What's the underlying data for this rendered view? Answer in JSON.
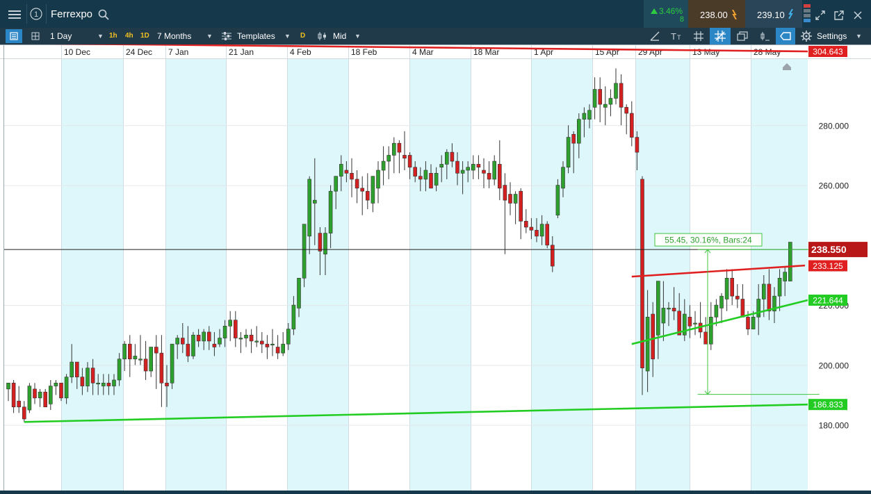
{
  "header": {
    "instrument": "Ferrexpo",
    "change_pct": "3.46%",
    "change_points": "8",
    "sell_price": "238.00",
    "buy_price": "239.10"
  },
  "toolbar": {
    "timeframe": "1 Day",
    "quick_1h": "1h",
    "quick_4h": "4h",
    "quick_1d": "1D",
    "range": "7 Months",
    "templates": "Templates",
    "d_badge": "D",
    "price_type": "Mid",
    "settings": "Settings"
  },
  "colors": {
    "up": "#2ea02e",
    "down": "#d42020",
    "resistance": "#e02020",
    "support": "#22cc22",
    "band": "#ddf7fa",
    "topbar": "#15384b",
    "toolbar": "#213a4a"
  },
  "chart_data": {
    "type": "candlestick",
    "x_tick_labels": [
      "10 Dec",
      "24 Dec",
      "7 Jan",
      "21 Jan",
      "4 Feb",
      "18 Feb",
      "4 Mar",
      "18 Mar",
      "1 Apr",
      "15 Apr",
      "29 Apr",
      "13 May",
      "28 May"
    ],
    "y_tick_labels": [
      "180.000",
      "200.000",
      "220.000",
      "260.000",
      "280.000"
    ],
    "y_ticks": [
      180,
      200,
      220,
      260,
      280
    ],
    "ylim": [
      172.5,
      306.5
    ],
    "current_price_label": "238.550",
    "current_price": 238.55,
    "price_labels": [
      {
        "text": "304.643",
        "value": 304.643,
        "color": "#e02020"
      },
      {
        "text": "233.125",
        "value": 233.125,
        "color": "#e02020"
      },
      {
        "text": "221.644",
        "value": 221.644,
        "color": "#22cc22"
      },
      {
        "text": "186.833",
        "value": 186.833,
        "color": "#22cc22"
      }
    ],
    "measure_label": "55.45, 30.16%, Bars:24",
    "measure": {
      "from_value": 190.2,
      "to_value": 238.55,
      "from_index": 131,
      "to_index": 153
    },
    "trendlines": [
      {
        "role": "long-term resistance",
        "color": "#e02020",
        "from_index": 0,
        "from_value": 307.4,
        "to_index": 153,
        "to_value": 304.643,
        "dashed_extension": false
      },
      {
        "role": "long-term support",
        "color": "#22cc22",
        "from_index": 3,
        "from_value": 181.0,
        "to_index": 153,
        "to_value": 186.833,
        "dashed_extension": false
      },
      {
        "role": "wedge resistance",
        "color": "#e02020",
        "from_index": 118,
        "from_value": 229.5,
        "to_index": 150,
        "to_value": 233.125,
        "dashed_extension": true
      },
      {
        "role": "wedge support",
        "color": "#22cc22",
        "from_index": 118,
        "from_value": 207.0,
        "to_index": 153,
        "to_value": 221.644,
        "dashed_extension": false
      }
    ],
    "candles": [
      [
        192,
        194,
        188,
        194
      ],
      [
        194,
        195,
        184,
        186
      ],
      [
        188,
        193,
        184,
        186
      ],
      [
        186,
        188,
        181,
        182
      ],
      [
        185,
        194,
        184,
        193
      ],
      [
        192,
        194,
        187,
        189
      ],
      [
        189,
        192,
        186,
        191
      ],
      [
        191,
        192,
        186,
        186
      ],
      [
        187,
        195,
        185,
        193
      ],
      [
        193,
        195,
        190,
        194
      ],
      [
        194,
        194,
        188,
        189
      ],
      [
        189,
        197,
        187,
        196
      ],
      [
        196,
        207,
        194,
        201
      ],
      [
        201,
        201,
        192,
        196
      ],
      [
        196,
        199,
        190,
        193
      ],
      [
        193,
        201,
        191,
        199
      ],
      [
        199,
        202,
        190,
        194
      ],
      [
        194,
        197,
        190,
        194
      ],
      [
        193,
        197,
        190,
        194
      ],
      [
        194,
        197,
        190,
        193
      ],
      [
        193,
        197,
        190,
        195
      ],
      [
        195,
        204,
        193,
        202
      ],
      [
        202,
        208,
        198,
        207
      ],
      [
        207,
        210,
        196,
        202
      ],
      [
        202,
        207,
        200,
        203
      ],
      [
        202,
        210,
        200,
        202
      ],
      [
        202,
        208,
        195,
        198
      ],
      [
        198,
        206,
        196,
        206
      ],
      [
        206,
        210,
        192,
        204
      ],
      [
        204,
        210,
        186,
        194
      ],
      [
        194,
        200,
        186,
        193
      ],
      [
        194,
        207,
        192,
        207
      ],
      [
        207,
        210,
        202,
        209
      ],
      [
        209,
        214,
        204,
        207
      ],
      [
        207,
        213,
        201,
        203
      ],
      [
        203,
        211,
        202,
        210
      ],
      [
        210,
        212,
        206,
        208
      ],
      [
        208,
        212,
        205,
        211
      ],
      [
        211,
        213,
        205,
        208
      ],
      [
        207,
        211,
        203,
        206
      ],
      [
        207,
        212,
        206,
        209
      ],
      [
        209,
        215,
        206,
        213
      ],
      [
        213,
        218,
        208,
        215
      ],
      [
        215,
        218,
        206,
        209
      ],
      [
        209,
        211,
        204,
        209
      ],
      [
        209,
        212,
        206,
        210
      ],
      [
        210,
        212,
        204,
        208
      ],
      [
        208,
        213,
        206,
        208
      ],
      [
        208,
        211,
        204,
        207
      ],
      [
        207,
        210,
        202,
        206
      ],
      [
        207,
        212,
        203,
        207
      ],
      [
        206,
        210,
        202,
        204
      ],
      [
        204,
        211,
        203,
        207
      ],
      [
        207,
        214,
        205,
        212
      ],
      [
        212,
        223,
        210,
        220
      ],
      [
        219,
        228,
        216,
        229
      ],
      [
        229,
        243,
        226,
        247
      ],
      [
        243,
        263,
        237,
        262
      ],
      [
        254,
        269,
        240,
        255
      ],
      [
        244,
        246,
        230,
        238
      ],
      [
        237,
        246,
        230,
        244
      ],
      [
        244,
        260,
        239,
        258
      ],
      [
        258,
        262,
        252,
        263
      ],
      [
        263,
        270,
        258,
        267
      ],
      [
        265,
        268,
        261,
        264
      ],
      [
        264,
        269,
        256,
        262
      ],
      [
        262,
        265,
        254,
        259
      ],
      [
        259,
        263,
        250,
        258
      ],
      [
        258,
        264,
        252,
        255
      ],
      [
        254,
        263,
        251,
        263
      ],
      [
        259,
        268,
        254,
        265
      ],
      [
        265,
        273,
        260,
        268
      ],
      [
        268,
        273,
        262,
        270
      ],
      [
        270,
        276,
        264,
        274
      ],
      [
        274,
        275,
        264,
        271
      ],
      [
        270,
        278,
        265,
        269
      ],
      [
        270,
        271,
        262,
        266
      ],
      [
        266,
        268,
        261,
        263
      ],
      [
        263,
        266,
        258,
        262
      ],
      [
        262,
        268,
        258,
        265
      ],
      [
        264,
        267,
        260,
        259
      ],
      [
        260,
        266,
        258,
        264
      ],
      [
        266,
        270,
        261,
        267
      ],
      [
        267,
        272,
        262,
        271
      ],
      [
        271,
        274,
        266,
        268
      ],
      [
        268,
        271,
        260,
        264
      ],
      [
        264,
        268,
        257,
        265
      ],
      [
        265,
        268,
        261,
        266
      ],
      [
        265,
        270,
        262,
        267
      ],
      [
        267,
        270,
        262,
        266
      ],
      [
        265,
        269,
        259,
        264
      ],
      [
        264,
        268,
        259,
        262
      ],
      [
        262,
        270,
        260,
        268
      ],
      [
        267,
        275,
        255,
        259
      ],
      [
        260,
        264,
        237,
        255
      ],
      [
        257,
        261,
        250,
        254
      ],
      [
        254,
        258,
        247,
        257
      ],
      [
        258,
        259,
        242,
        248
      ],
      [
        248,
        252,
        244,
        246
      ],
      [
        246,
        249,
        242,
        245
      ],
      [
        245,
        249,
        241,
        243
      ],
      [
        243,
        250,
        240,
        247
      ],
      [
        247,
        248,
        239,
        240
      ],
      [
        240,
        243,
        231,
        233
      ],
      [
        250,
        262,
        249,
        260
      ],
      [
        259,
        268,
        256,
        266
      ],
      [
        266,
        280,
        264,
        276
      ],
      [
        277,
        278,
        264,
        274
      ],
      [
        274,
        284,
        269,
        282
      ],
      [
        282,
        286,
        276,
        284
      ],
      [
        282,
        287,
        279,
        285
      ],
      [
        286,
        296,
        282,
        292
      ],
      [
        292,
        296,
        281,
        287
      ],
      [
        286,
        293,
        280,
        287
      ],
      [
        287,
        292,
        283,
        289
      ],
      [
        289,
        299,
        287,
        294
      ],
      [
        294,
        297,
        280,
        286
      ],
      [
        286,
        287,
        277,
        284
      ],
      [
        284,
        288,
        273,
        276
      ],
      [
        276,
        278,
        265,
        271
      ],
      [
        262,
        263,
        190,
        199
      ],
      [
        198,
        225,
        191,
        216
      ],
      [
        217,
        221,
        196,
        202
      ],
      [
        210,
        228,
        202,
        228
      ],
      [
        214,
        228,
        208,
        219
      ],
      [
        219,
        221,
        213,
        219
      ],
      [
        219,
        226,
        215,
        218
      ],
      [
        218,
        224,
        212,
        210
      ],
      [
        210,
        222,
        208,
        217
      ],
      [
        216,
        220,
        209,
        213
      ],
      [
        214,
        218,
        210,
        214
      ],
      [
        214,
        221,
        209,
        211
      ],
      [
        211,
        216,
        207,
        207
      ],
      [
        207,
        221,
        205,
        216
      ],
      [
        216,
        222,
        213,
        220
      ],
      [
        219,
        224,
        214,
        223
      ],
      [
        222,
        232,
        218,
        229
      ],
      [
        229,
        232,
        220,
        223
      ],
      [
        223,
        227,
        219,
        222
      ],
      [
        222,
        227,
        217,
        216
      ],
      [
        216,
        218,
        210,
        212
      ],
      [
        212,
        218,
        212,
        216
      ],
      [
        216,
        227,
        210,
        222
      ],
      [
        222,
        230,
        216,
        227
      ],
      [
        227,
        232,
        215,
        218
      ],
      [
        218,
        226,
        214,
        223
      ],
      [
        223,
        232,
        218,
        229
      ],
      [
        228,
        233,
        223,
        231
      ],
      [
        228,
        237,
        228,
        241
      ]
    ]
  }
}
